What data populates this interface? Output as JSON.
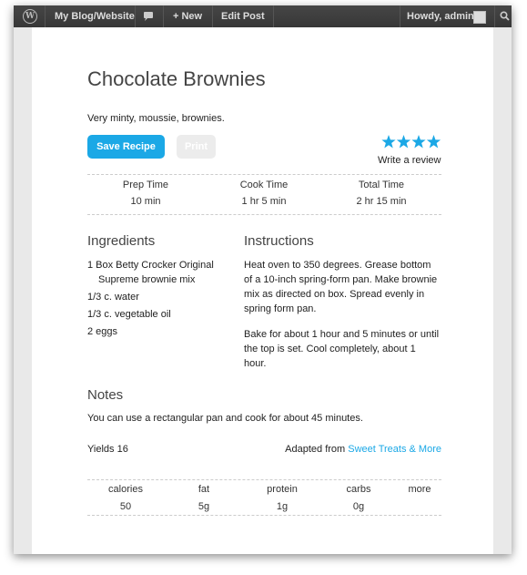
{
  "adminbar": {
    "site": "My Blog/Website",
    "new_label": "+ New",
    "edit_post": "Edit Post",
    "howdy": "Howdy, admin"
  },
  "recipe": {
    "title": "Chocolate Brownies",
    "summary": "Very minty, moussie, brownies.",
    "save_label": "Save Recipe",
    "print_label": "Print",
    "rating_stars": 4,
    "write_review": "Write a review",
    "times": [
      {
        "label": "Prep Time",
        "value": "10 min"
      },
      {
        "label": "Cook Time",
        "value": "1 hr 5 min"
      },
      {
        "label": "Total Time",
        "value": "2 hr 15 min"
      }
    ],
    "ingredients_heading": "Ingredients",
    "ingredients": [
      {
        "line1": "1 Box Betty Crocker Original",
        "line2": "Supreme brownie mix"
      },
      {
        "line1": "1/3 c. water",
        "line2": ""
      },
      {
        "line1": "1/3 c. vegetable oil",
        "line2": ""
      },
      {
        "line1": "2 eggs",
        "line2": ""
      }
    ],
    "instructions_heading": "Instructions",
    "instructions": [
      [
        "Heat oven to 350 degrees. Grease bottom",
        "of a 10-inch spring-form pan. Make brownie",
        "mix as directed on box. Spread evenly in",
        "spring form pan."
      ],
      [
        "Bake for about 1 hour and 5 minutes or until",
        "the top is set. Cool completely, about 1",
        "hour."
      ]
    ],
    "notes_heading": "Notes",
    "notes": "You can use a rectangular pan and cook for about 45 minutes.",
    "yields": "Yields 16",
    "adapted_prefix": "Adapted from",
    "adapted_link": "Sweet Treats & More",
    "nutrition": [
      {
        "label": "calories",
        "value": "50"
      },
      {
        "label": "fat",
        "value": "5g"
      },
      {
        "label": "protein",
        "value": "1g"
      },
      {
        "label": "carbs",
        "value": "0g"
      },
      {
        "label": "more",
        "value": ""
      }
    ]
  },
  "colors": {
    "accent": "#1ba8e6",
    "adminbar": "#3c3c3c"
  }
}
